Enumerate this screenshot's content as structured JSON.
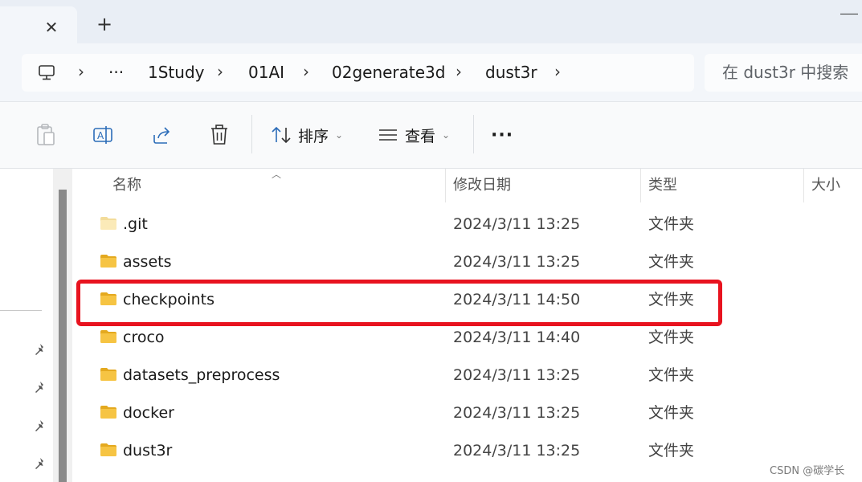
{
  "tab": {
    "close_glyph": "✕",
    "new_glyph": "+"
  },
  "breadcrumb": {
    "overflow": "···",
    "items": [
      "1Study",
      "01AI",
      "02generate3d",
      "dust3r"
    ],
    "separator": "›"
  },
  "search": {
    "placeholder": "在 dust3r 中搜索"
  },
  "toolbar": {
    "sort_label": "排序",
    "view_label": "查看",
    "more_label": "···"
  },
  "columns": {
    "name": "名称",
    "modified": "修改日期",
    "type": "类型",
    "size": "大小"
  },
  "files": [
    {
      "name": ".git",
      "modified": "2024/3/11 13:25",
      "type": "文件夹",
      "faded": true
    },
    {
      "name": "assets",
      "modified": "2024/3/11 13:25",
      "type": "文件夹",
      "faded": false
    },
    {
      "name": "checkpoints",
      "modified": "2024/3/11 14:50",
      "type": "文件夹",
      "faded": false
    },
    {
      "name": "croco",
      "modified": "2024/3/11 14:40",
      "type": "文件夹",
      "faded": false
    },
    {
      "name": "datasets_preprocess",
      "modified": "2024/3/11 13:25",
      "type": "文件夹",
      "faded": false
    },
    {
      "name": "docker",
      "modified": "2024/3/11 13:25",
      "type": "文件夹",
      "faded": false
    },
    {
      "name": "dust3r",
      "modified": "2024/3/11 13:25",
      "type": "文件夹",
      "faded": false
    }
  ],
  "watermark": "CSDN @碳学长",
  "colors": {
    "highlight": "#e8131f",
    "folder": "#f6c443",
    "folder_dark": "#e4a91f"
  },
  "icons": [
    "computer-icon",
    "paste-icon",
    "rename-icon",
    "share-icon",
    "delete-icon",
    "sort-icon",
    "view-icon",
    "pin-icon",
    "folder-icon"
  ]
}
